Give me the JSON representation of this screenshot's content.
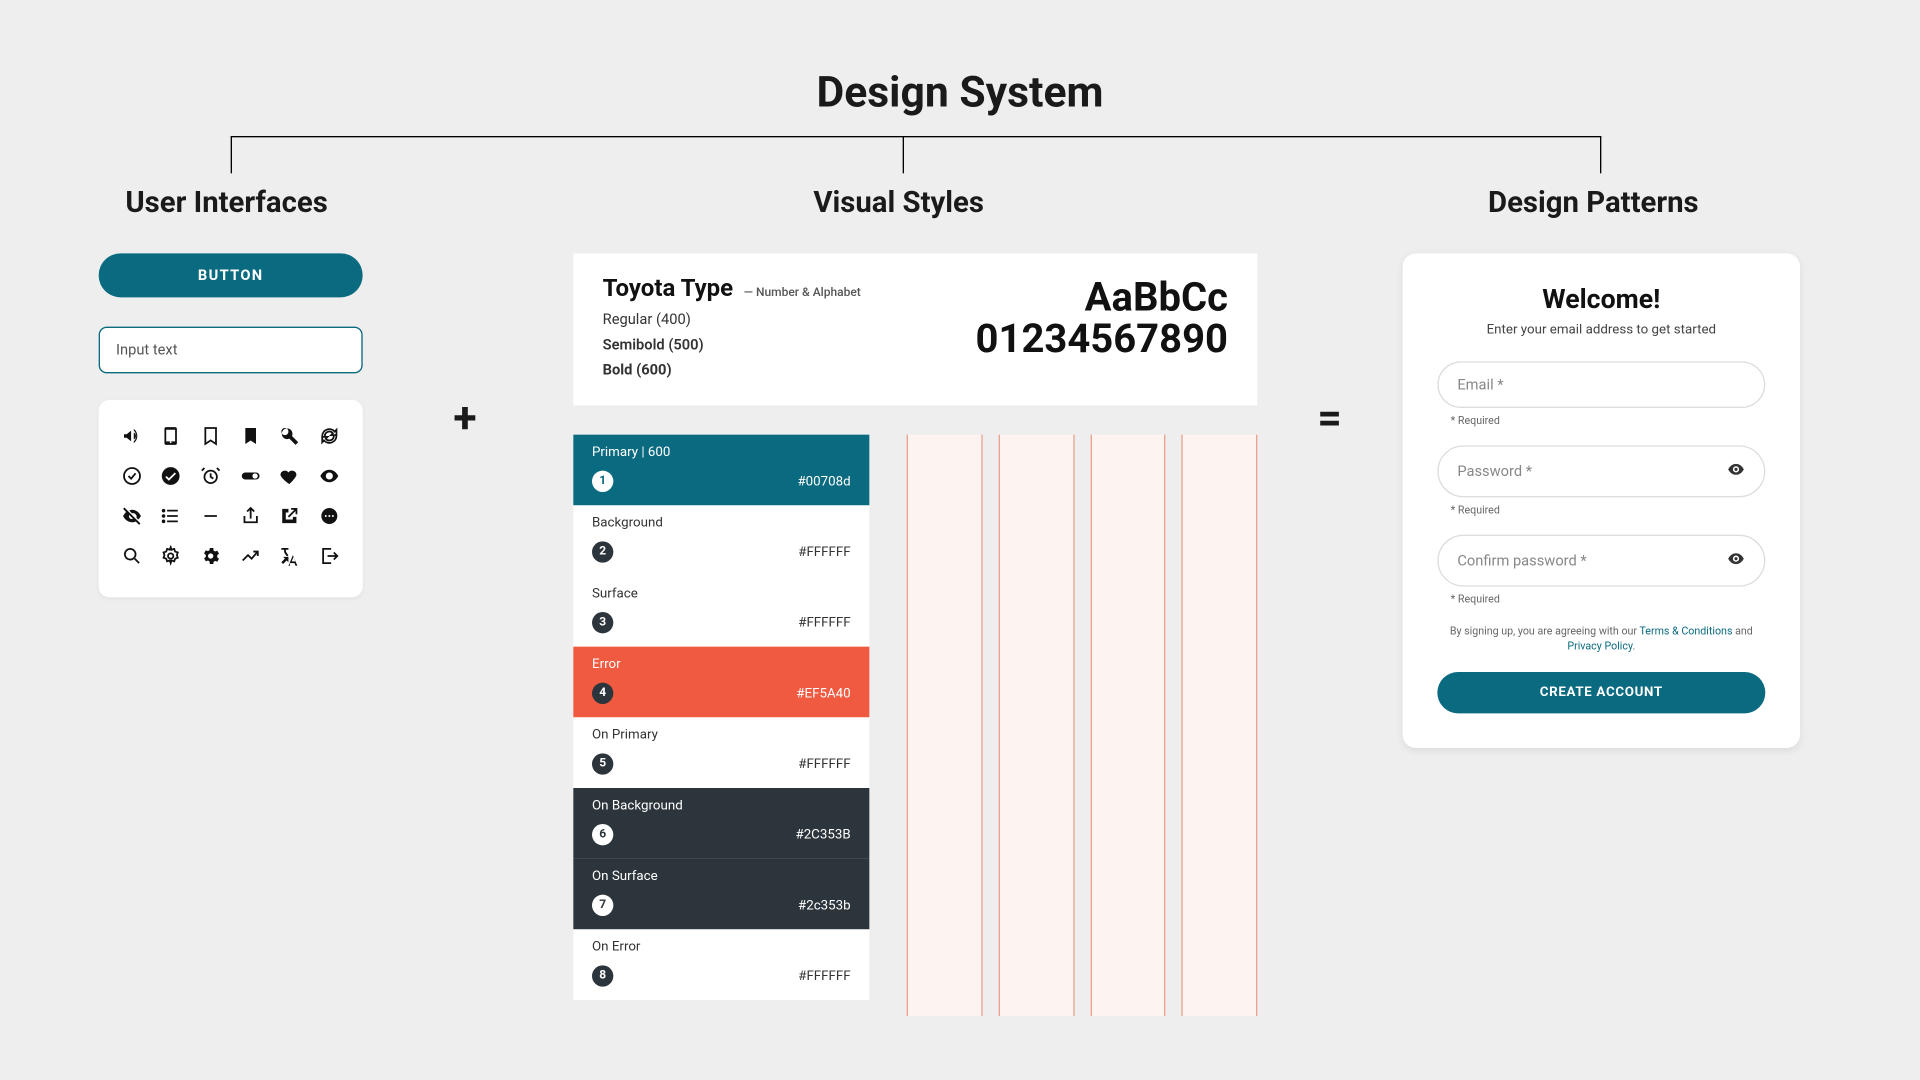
{
  "title": "Design System",
  "operators": {
    "plus": "+",
    "equals": "="
  },
  "columns": {
    "ui": {
      "header": "User Interfaces"
    },
    "vs": {
      "header": "Visual Styles"
    },
    "dp": {
      "header": "Design Patterns"
    }
  },
  "ui": {
    "button_label": "BUTTON",
    "input_placeholder": "Input text",
    "icons": [
      "campaign",
      "smartphone",
      "bookmark-border",
      "bookmark",
      "build",
      "sync",
      "check-circle-outline",
      "check-circle",
      "alarm",
      "toggle-on",
      "favorite",
      "visibility",
      "visibility-off",
      "list",
      "remove",
      "ios-share",
      "open-in-new",
      "more-horiz",
      "search",
      "settings-outline",
      "settings",
      "trending",
      "translate",
      "logout"
    ]
  },
  "typography": {
    "name": "Toyota Type",
    "sub": "— Number & Alphabet",
    "weights": [
      "Regular (400)",
      "Semibold (500)",
      "Bold (600)"
    ],
    "sample_alpha": "AaBbCc",
    "sample_num": "01234567890"
  },
  "palette": [
    {
      "name": "Primary | 600",
      "hex": "#00708d",
      "bg": "#0a6a80",
      "fg": "#ffffff",
      "swatch_bg": "#ffffff",
      "swatch_fg": "#0a6a80",
      "idx": "1"
    },
    {
      "name": "Background",
      "hex": "#FFFFFF",
      "bg": "#ffffff",
      "fg": "#333333",
      "swatch_bg": "#2c353b",
      "swatch_fg": "#ffffff",
      "idx": "2"
    },
    {
      "name": "Surface",
      "hex": "#FFFFFF",
      "bg": "#ffffff",
      "fg": "#333333",
      "swatch_bg": "#2c353b",
      "swatch_fg": "#ffffff",
      "idx": "3"
    },
    {
      "name": "Error",
      "hex": "#EF5A40",
      "bg": "#ef5a40",
      "fg": "#ffffff",
      "swatch_bg": "#2c353b",
      "swatch_fg": "#ffffff",
      "idx": "4"
    },
    {
      "name": "On Primary",
      "hex": "#FFFFFF",
      "bg": "#ffffff",
      "fg": "#333333",
      "swatch_bg": "#2c353b",
      "swatch_fg": "#ffffff",
      "idx": "5"
    },
    {
      "name": "On Background",
      "hex": "#2C353B",
      "bg": "#2c353b",
      "fg": "#ffffff",
      "swatch_bg": "#ffffff",
      "swatch_fg": "#2c353b",
      "idx": "6"
    },
    {
      "name": "On Surface",
      "hex": "#2c353b",
      "bg": "#2c353b",
      "fg": "#ffffff",
      "swatch_bg": "#ffffff",
      "swatch_fg": "#2c353b",
      "idx": "7"
    },
    {
      "name": "On Error",
      "hex": "#FFFFFF",
      "bg": "#ffffff",
      "fg": "#333333",
      "swatch_bg": "#2c353b",
      "swatch_fg": "#ffffff",
      "idx": "8"
    }
  ],
  "form": {
    "title": "Welcome!",
    "subtitle": "Enter your email address to get started",
    "email_placeholder": "Email *",
    "password_placeholder": "Password *",
    "confirm_placeholder": "Confirm password *",
    "required": "* Required",
    "terms_prefix": "By signing up, you are agreeing with our ",
    "terms_link": "Terms & Conditions",
    "terms_mid": " and ",
    "privacy_link": "Privacy Policy",
    "terms_suffix": ".",
    "cta": "CREATE ACCOUNT"
  }
}
